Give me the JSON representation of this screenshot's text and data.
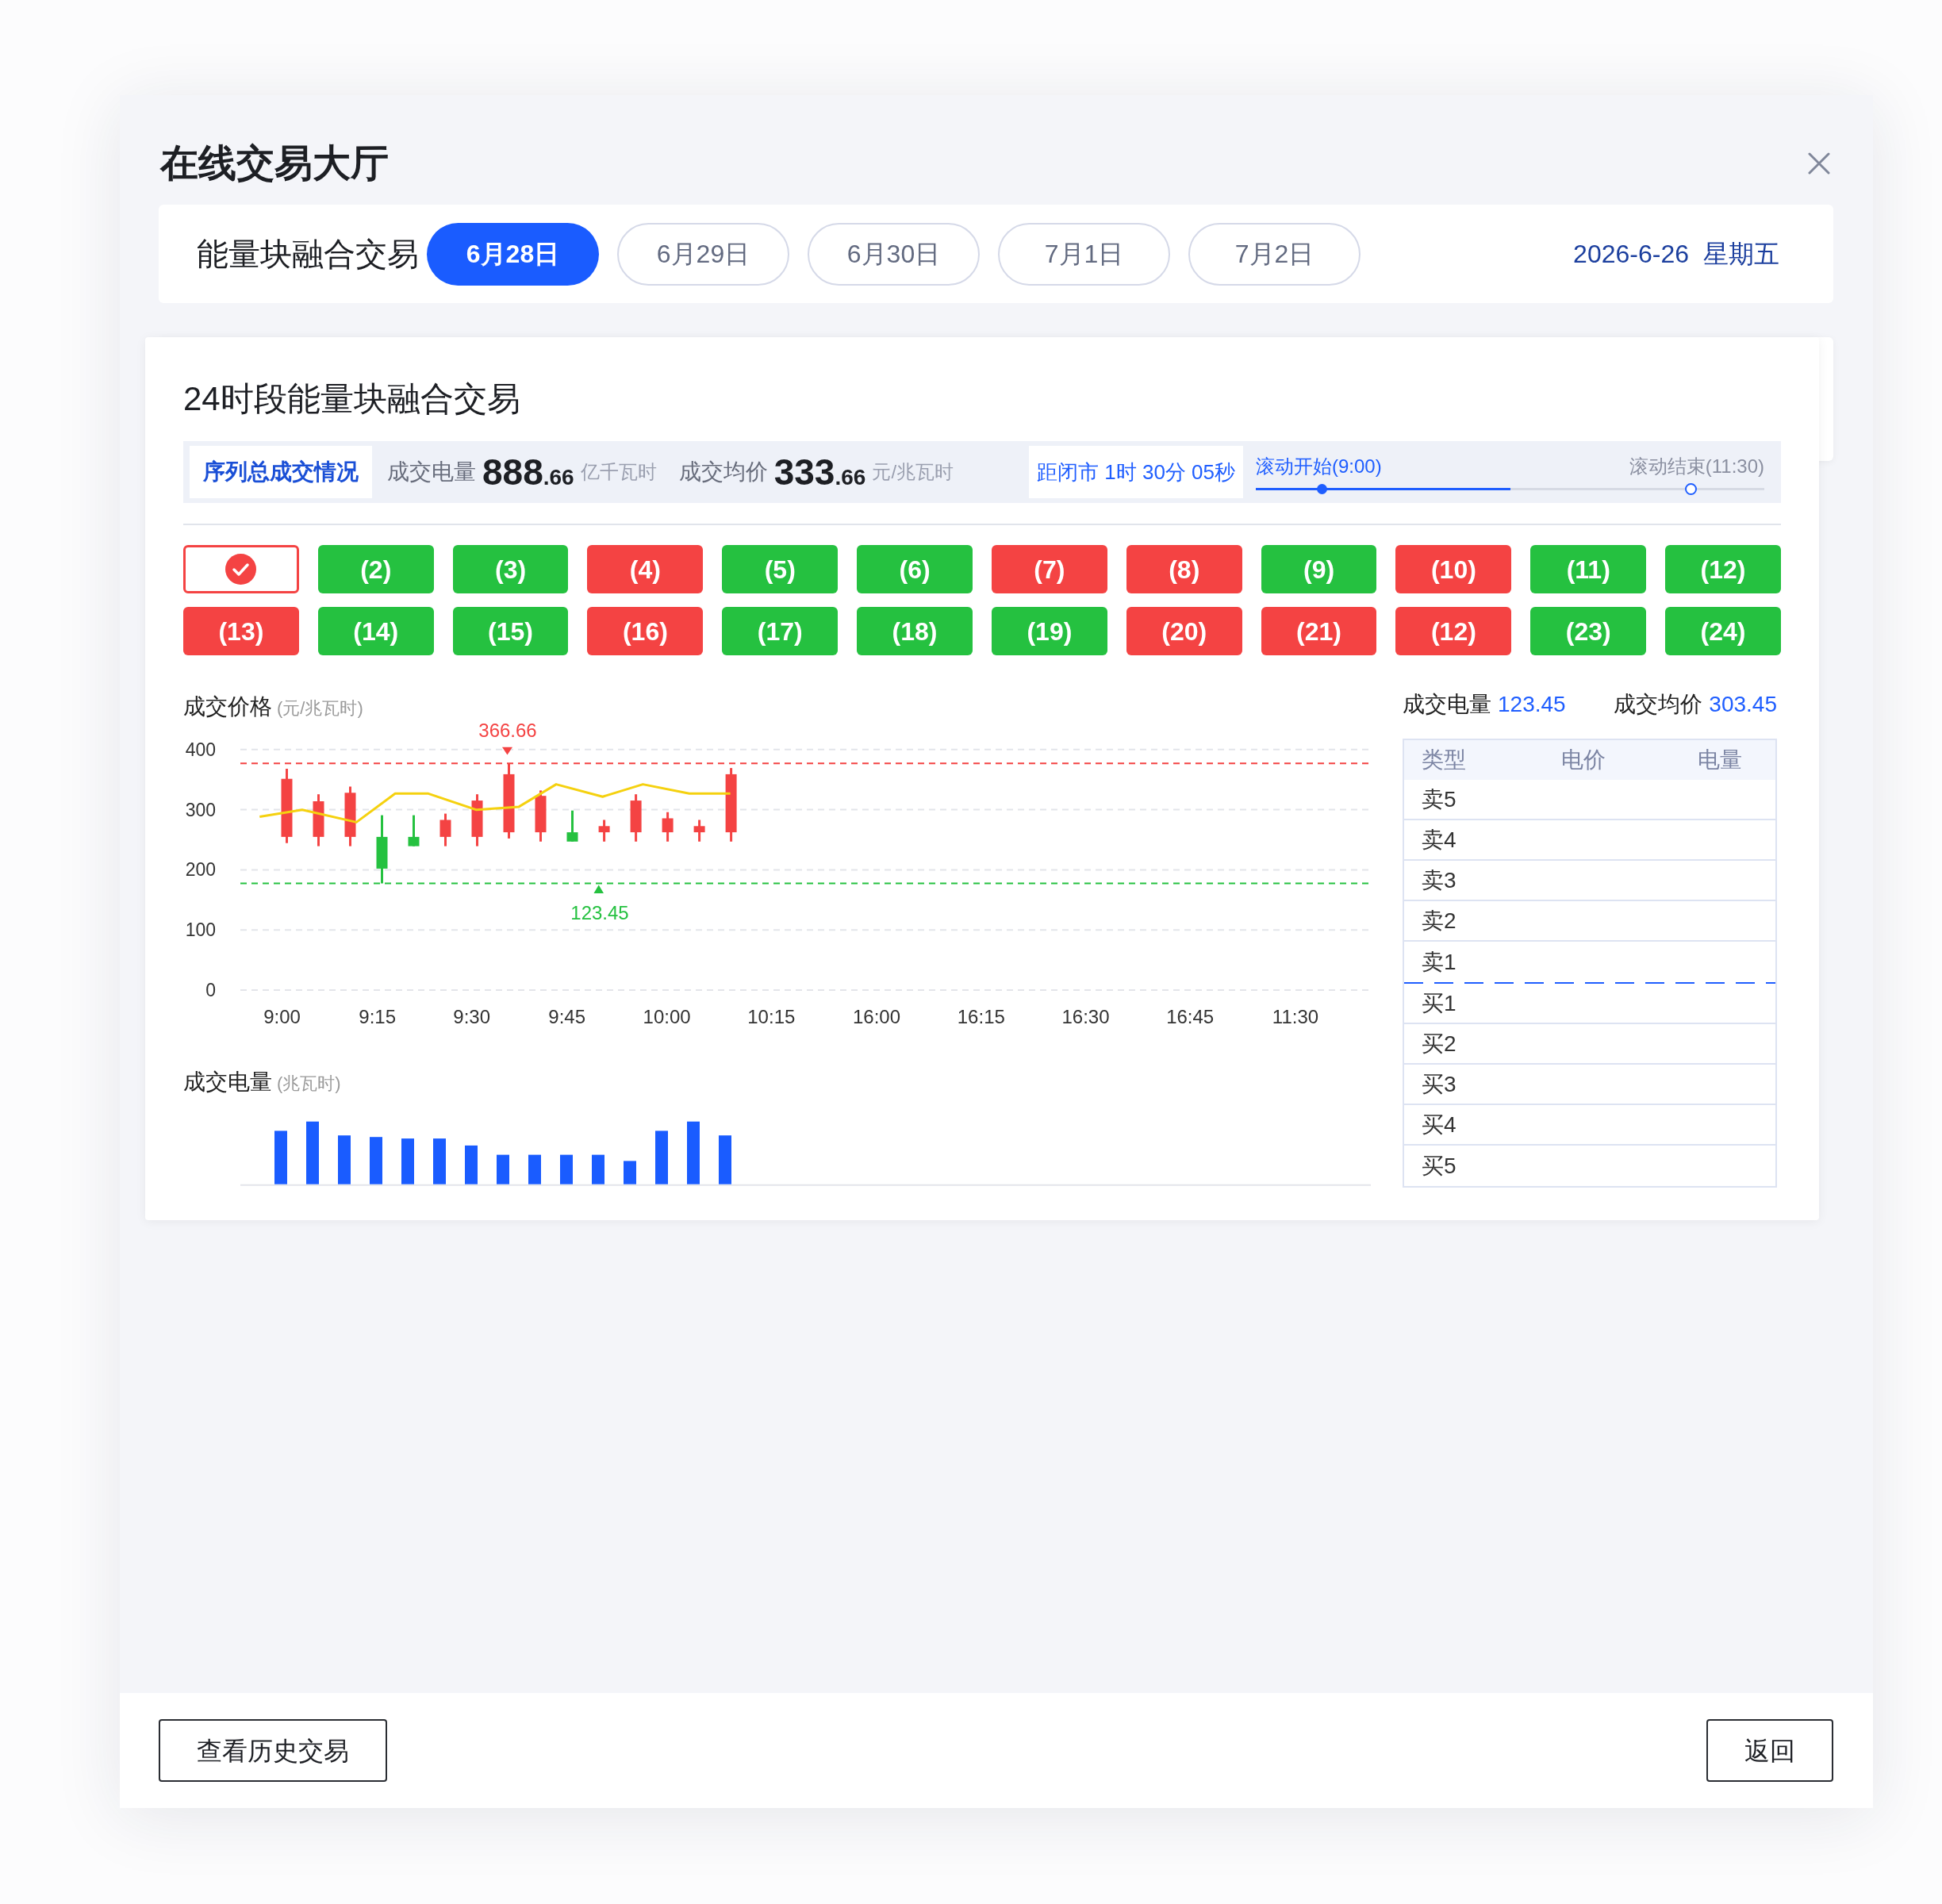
{
  "dialog": {
    "title": "在线交易大厅"
  },
  "date_bar": {
    "label": "能量块融合交易",
    "tabs": [
      {
        "label": "6月28日",
        "selected": true
      },
      {
        "label": "6月29日",
        "selected": false
      },
      {
        "label": "6月30日",
        "selected": false
      },
      {
        "label": "7月1日",
        "selected": false
      },
      {
        "label": "7月2日",
        "selected": false
      }
    ],
    "date": "2026-6-26",
    "weekday": "星期五"
  },
  "panel": {
    "title": "24时段能量块融合交易",
    "summary": {
      "badge": "序列总成交情况",
      "volume_label": "成交电量",
      "volume_value": "888",
      "volume_decimals": ".66",
      "volume_unit": "亿千瓦时",
      "price_label": "成交均价",
      "price_value": "333",
      "price_decimals": ".66",
      "price_unit": "元/兆瓦时",
      "countdown": "距闭市 1时 30分 05秒",
      "timeline": {
        "start_label": "滚动开始(9:00)",
        "end_label": "滚动结束(11:30)",
        "level": 0.5
      }
    },
    "periods": [
      {
        "selected": true,
        "color": "#f44343"
      },
      {
        "label": "(2)",
        "selected": false,
        "color": "#25c140"
      },
      {
        "label": "(3)",
        "selected": false,
        "color": "#25c140"
      },
      {
        "label": "(4)",
        "selected": false,
        "color": "#f44343"
      },
      {
        "label": "(5)",
        "selected": false,
        "color": "#25c140"
      },
      {
        "label": "(6)",
        "selected": false,
        "color": "#25c140"
      },
      {
        "label": "(7)",
        "selected": false,
        "color": "#f44343"
      },
      {
        "label": "(8)",
        "selected": false,
        "color": "#f44343"
      },
      {
        "label": "(9)",
        "selected": false,
        "color": "#25c140"
      },
      {
        "label": "(10)",
        "selected": false,
        "color": "#f44343"
      },
      {
        "label": "(11)",
        "selected": false,
        "color": "#25c140"
      },
      {
        "label": "(12)",
        "selected": false,
        "color": "#25c140"
      },
      {
        "label": "(13)",
        "selected": false,
        "color": "#f44343"
      },
      {
        "label": "(14)",
        "selected": false,
        "color": "#25c140"
      },
      {
        "label": "(15)",
        "selected": false,
        "color": "#25c140"
      },
      {
        "label": "(16)",
        "selected": false,
        "color": "#f44343"
      },
      {
        "label": "(17)",
        "selected": false,
        "color": "#25c140"
      },
      {
        "label": "(18)",
        "selected": false,
        "color": "#25c140"
      },
      {
        "label": "(19)",
        "selected": false,
        "color": "#25c140"
      },
      {
        "label": "(20)",
        "selected": false,
        "color": "#f44343"
      },
      {
        "label": "(21)",
        "selected": false,
        "color": "#f44343"
      },
      {
        "label": "(12)",
        "selected": false,
        "color": "#f44343"
      },
      {
        "label": "(23)",
        "selected": false,
        "color": "#25c140"
      },
      {
        "label": "(24)",
        "selected": false,
        "color": "#25c140"
      }
    ],
    "price_chart": {
      "title": "成交价格",
      "unit": "(元/兆瓦时)",
      "y_labels": [
        "400",
        "300",
        "200",
        "100",
        "0"
      ],
      "x_labels": [
        "9:00",
        "9:15",
        "9:30",
        "9:45",
        "10:00",
        "10:15",
        "16:00",
        "16:15",
        "16:30",
        "16:45",
        "11:30"
      ],
      "max_label": "366.66",
      "min_label": "123.45"
    },
    "volume_chart": {
      "title": "成交电量",
      "unit": "(兆瓦时)"
    },
    "order_book": {
      "volume_label": "成交电量",
      "volume": "123.45",
      "price_label": "成交均价",
      "price": "303.45",
      "columns": [
        "类型",
        "电价",
        "电量"
      ],
      "sell_rows": [
        {
          "type": "卖5"
        },
        {
          "type": "卖4"
        },
        {
          "type": "卖3"
        },
        {
          "type": "卖2"
        },
        {
          "type": "卖1"
        }
      ],
      "buy_rows": [
        {
          "type": "买1"
        },
        {
          "type": "买2"
        },
        {
          "type": "买3"
        },
        {
          "type": "买4"
        },
        {
          "type": "买5"
        }
      ]
    }
  },
  "footer": {
    "buttons": [
      "查看历史交易",
      "返回"
    ]
  }
}
